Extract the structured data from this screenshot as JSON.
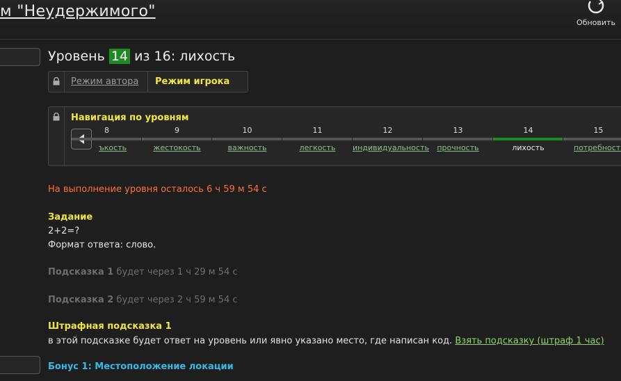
{
  "header": {
    "game_title": "м \"Неудержимого\"",
    "refresh_label": "Обновить"
  },
  "level": {
    "prefix": "Уровень",
    "number": "14",
    "middle": "из 16: лихость"
  },
  "modes": {
    "author": "Режим автора",
    "player": "Режим игрока"
  },
  "navigation": {
    "title": "Навигация по уровням",
    "levels": [
      {
        "num": "8",
        "name": "ъкость"
      },
      {
        "num": "9",
        "name": "жестокость"
      },
      {
        "num": "10",
        "name": "важность"
      },
      {
        "num": "11",
        "name": "легкость"
      },
      {
        "num": "12",
        "name": "индивидуальность"
      },
      {
        "num": "13",
        "name": "прочность"
      },
      {
        "num": "14",
        "name": "лихость"
      },
      {
        "num": "15",
        "name": "потребность"
      }
    ],
    "current": "14"
  },
  "timer": "На выполнение уровня осталось 6 ч 59 м 54 с",
  "task": {
    "title": "Задание",
    "line1": "2+2=?",
    "line2": "Формат ответа: слово."
  },
  "hints": [
    {
      "label": "Подсказка 1",
      "text": " будет через 1 ч 29 м 54 с"
    },
    {
      "label": "Подсказка 2",
      "text": " будет через 2 ч 59 м 54 с"
    }
  ],
  "penalty_hint": {
    "title": "Штрафная подсказка 1",
    "text": "в этой подсказке будет ответ на уровень или явно указано место, где написан код.",
    "link": "Взять подсказку (штраф 1 час)"
  },
  "bonus": "Бонус 1: Местоположение локации",
  "colors": {
    "accent_yellow": "#f2e63a",
    "accent_green": "#1f8a22",
    "timer_orange": "#ff6e33",
    "bonus_blue": "#35b9e8"
  }
}
